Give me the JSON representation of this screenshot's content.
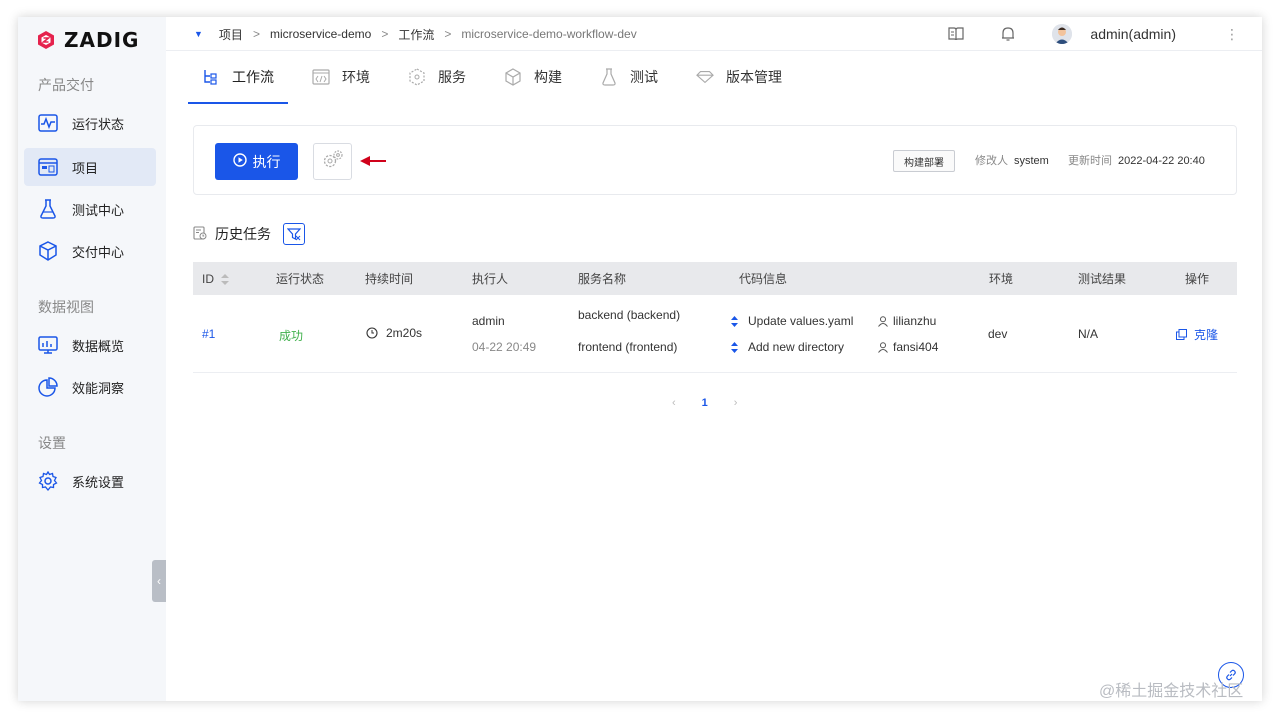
{
  "brand": {
    "name": "ZADIG"
  },
  "sidebar": {
    "groups": [
      {
        "title": "产品交付",
        "items": [
          {
            "label": "运行状态",
            "icon": "wave-monitor-icon"
          },
          {
            "label": "项目",
            "icon": "pm-board-icon",
            "active": true
          },
          {
            "label": "测试中心",
            "icon": "flask-icon"
          },
          {
            "label": "交付中心",
            "icon": "package-icon"
          }
        ]
      },
      {
        "title": "数据视图",
        "items": [
          {
            "label": "数据概览",
            "icon": "dashboard-icon"
          },
          {
            "label": "效能洞察",
            "icon": "pie-chart-icon"
          }
        ]
      },
      {
        "title": "设置",
        "items": [
          {
            "label": "系统设置",
            "icon": "gear-icon"
          }
        ]
      }
    ]
  },
  "breadcrumb": [
    "项目",
    "microservice-demo",
    "工作流",
    "microservice-demo-workflow-dev"
  ],
  "user": {
    "name": "admin(admin)"
  },
  "tabs": [
    {
      "label": "工作流",
      "icon": "workflow-icon",
      "active": true
    },
    {
      "label": "环境",
      "icon": "code-env-icon"
    },
    {
      "label": "服务",
      "icon": "service-cube-icon"
    },
    {
      "label": "构建",
      "icon": "build-cube-icon"
    },
    {
      "label": "测试",
      "icon": "test-flask-icon"
    },
    {
      "label": "版本管理",
      "icon": "version-diamond-icon"
    }
  ],
  "run": {
    "run_label": "执行",
    "badge": "构建部署",
    "modifier_label": "修改人",
    "modifier_value": "system",
    "updated_label": "更新时间",
    "updated_value": "2022-04-22 20:40"
  },
  "history": {
    "title": "历史任务",
    "columns": [
      "ID",
      "运行状态",
      "持续时间",
      "执行人",
      "服务名称",
      "代码信息",
      "环境",
      "测试结果",
      "操作"
    ],
    "rows": [
      {
        "id": "#1",
        "status": "成功",
        "duration": "2m20s",
        "executor": "admin",
        "executed_at": "04-22 20:49",
        "services": [
          "backend (backend)",
          "frontend (frontend)"
        ],
        "commits": [
          {
            "message": "Update values.yaml",
            "author": "lilianzhu"
          },
          {
            "message": "Add new directory",
            "author": "fansi404"
          }
        ],
        "env": "dev",
        "test_result": "N/A",
        "action": "克隆"
      }
    ]
  },
  "pagination": {
    "current": "1",
    "prev": "‹",
    "next": "›"
  },
  "watermark": "@稀土掘金技术社区",
  "colors": {
    "primary": "#1a56e8",
    "success": "#3fb04b",
    "arrow": "#d0021b"
  }
}
